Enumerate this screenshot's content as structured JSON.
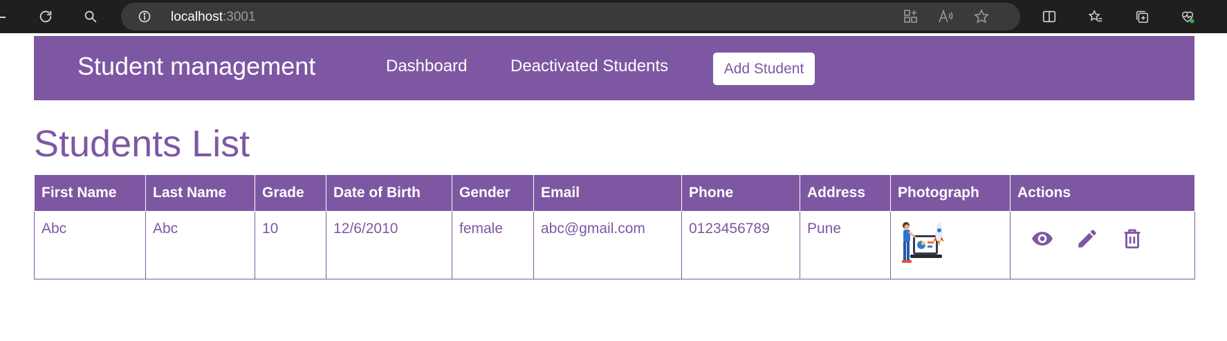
{
  "browser": {
    "url_host": "localhost",
    "url_port": ":3001"
  },
  "navbar": {
    "brand": "Student management",
    "links": [
      "Dashboard",
      "Deactivated Students"
    ],
    "add_button": "Add Student",
    "color": "#7e57a2"
  },
  "page": {
    "title": "Students List"
  },
  "table": {
    "headers": [
      "First Name",
      "Last Name",
      "Grade",
      "Date of Birth",
      "Gender",
      "Email",
      "Phone",
      "Address",
      "Photograph",
      "Actions"
    ],
    "rows": [
      {
        "first_name": "Abc",
        "last_name": "Abc",
        "grade": "10",
        "dob": "12/6/2010",
        "gender": "female",
        "email": "abc@gmail.com",
        "phone": "0123456789",
        "address": "Pune",
        "photograph": "student-illustration",
        "actions": [
          "view-icon",
          "edit-icon",
          "delete-icon"
        ]
      }
    ]
  }
}
